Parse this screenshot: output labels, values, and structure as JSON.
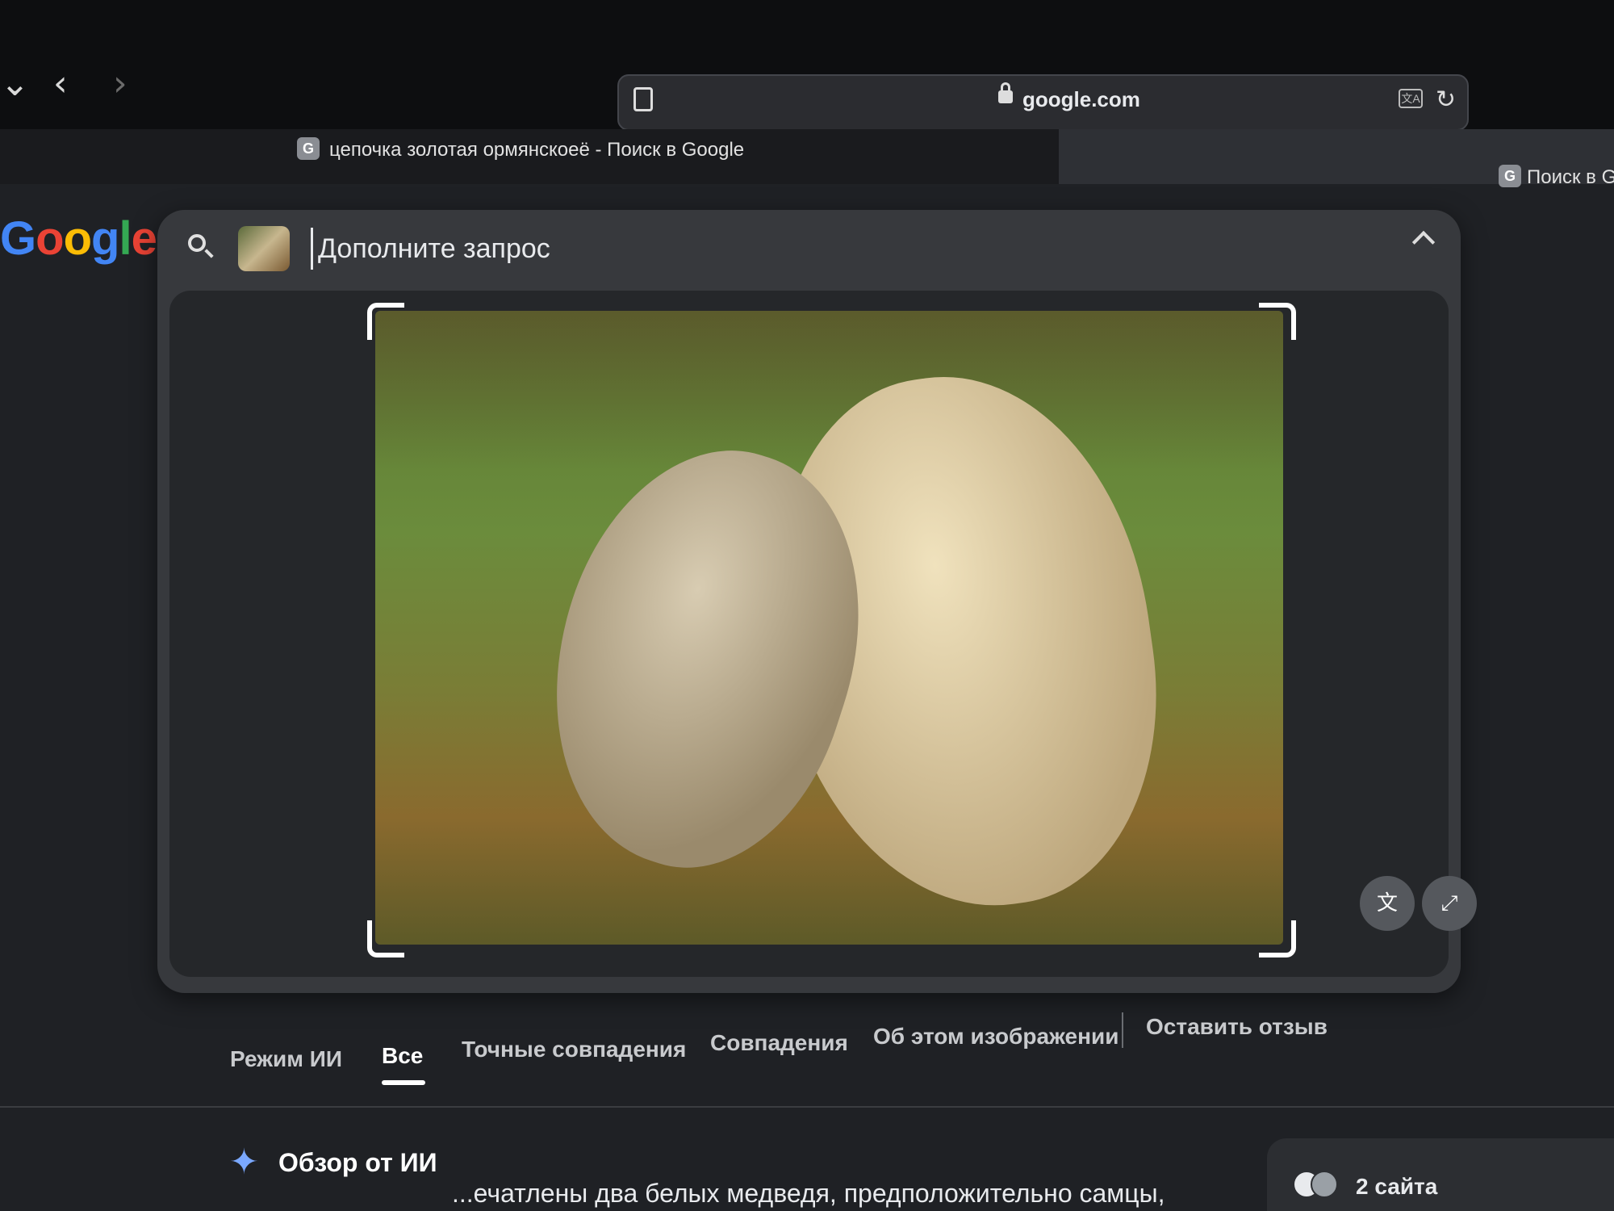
{
  "browser": {
    "url": "google.com",
    "tabs": [
      {
        "title": "цепочка золотая ормянскоeё - Поиск в Google",
        "active": true
      },
      {
        "title": "Поиск в Goo",
        "active": false
      }
    ]
  },
  "logo": "Google",
  "search": {
    "placeholder": "Дополните запрос"
  },
  "image_panel": {
    "translate_icon": "translate-icon",
    "fullscreen_icon": "expand-icon"
  },
  "filters": {
    "ai_mode": "Режим ИИ",
    "all": "Все",
    "exact": "Точные совпадения",
    "matches": "Совпадения",
    "about": "Об этом изображении",
    "feedback": "Оставить отзыв"
  },
  "ai_overview": {
    "title": "Обзор от ИИ",
    "text": "...ечатлены два белых медведя, предположительно самцы,",
    "sites": "2 сайта"
  },
  "colors": {
    "background": "#1f2125",
    "panel": "#37393d",
    "accent_sparkle": "#7aa8ff"
  }
}
